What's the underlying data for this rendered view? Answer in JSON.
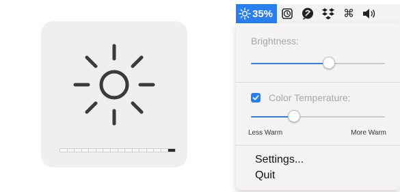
{
  "hud": {
    "icon": "sun-icon",
    "level": {
      "filled": 1,
      "total": 16
    }
  },
  "menubar": {
    "app_icon": "sun-icon",
    "app_value": "35%",
    "icons": [
      "clock-icon",
      "chat-bubble-icon",
      "dropbox-icon",
      "command-icon",
      "volume-icon"
    ]
  },
  "menu": {
    "brightness_label": "Brightness:",
    "brightness_value": 0.58,
    "color_temp_label": "Color Temperature:",
    "color_temp_checked": true,
    "color_temp_value": 0.32,
    "less_warm": "Less Warm",
    "more_warm": "More Warm",
    "settings": "Settings...",
    "quit": "Quit"
  },
  "colors": {
    "accent": "#2a7ff0",
    "hud_bg": "#efefef",
    "menu_bg": "#f4f2f2"
  }
}
